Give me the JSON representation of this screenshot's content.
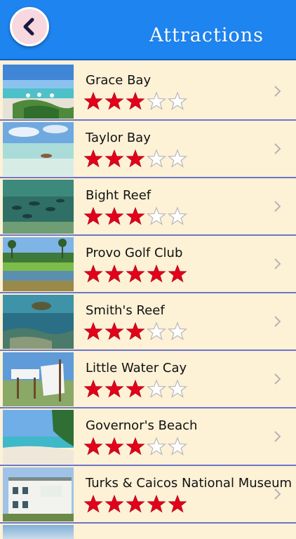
{
  "header": {
    "title": "Attractions",
    "back_icon": "chevron-left-icon",
    "background_color": "#1e84f0"
  },
  "colors": {
    "star_filled": "#e3001b",
    "star_empty_stroke": "#b8b8b8",
    "row_background": "#fdf1d6",
    "row_divider": "#6e75c9"
  },
  "attractions": [
    {
      "name": "Grace Bay",
      "rating": 3,
      "max_rating": 5
    },
    {
      "name": "Taylor Bay",
      "rating": 3,
      "max_rating": 5
    },
    {
      "name": "Bight Reef",
      "rating": 3,
      "max_rating": 5
    },
    {
      "name": "Provo Golf Club",
      "rating": 5,
      "max_rating": 5
    },
    {
      "name": "Smith's Reef",
      "rating": 3,
      "max_rating": 5
    },
    {
      "name": "Little Water Cay",
      "rating": 3,
      "max_rating": 5
    },
    {
      "name": "Governor's Beach",
      "rating": 3,
      "max_rating": 5
    },
    {
      "name": "Turks & Caicos National Museum",
      "rating": 5,
      "max_rating": 5
    }
  ]
}
